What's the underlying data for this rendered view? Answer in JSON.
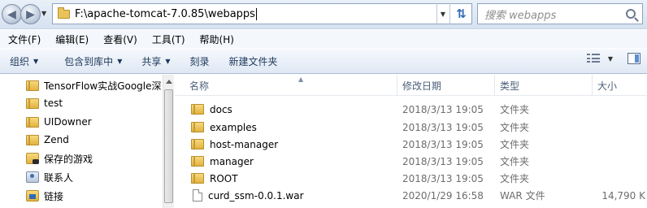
{
  "address_bar": {
    "path": "F:\\apache-tomcat-7.0.85\\webapps",
    "search_placeholder": "搜索 webapps"
  },
  "menu": [
    "文件(F)",
    "编辑(E)",
    "查看(V)",
    "工具(T)",
    "帮助(H)"
  ],
  "toolbar": {
    "organize": "组织",
    "include_in_library": "包含到库中",
    "share": "共享",
    "burn": "刻录",
    "new_folder": "新建文件夹"
  },
  "nav_items": [
    {
      "label": "TensorFlow实战Google深",
      "icon": "folder-icon"
    },
    {
      "label": "test",
      "icon": "folder-icon"
    },
    {
      "label": "UIDowner",
      "icon": "folder-icon"
    },
    {
      "label": "Zend",
      "icon": "folder-icon"
    },
    {
      "label": "保存的游戏",
      "icon": "saved-games-icon"
    },
    {
      "label": "联系人",
      "icon": "contacts-icon"
    },
    {
      "label": "链接",
      "icon": "links-icon"
    }
  ],
  "columns": {
    "name": "名称",
    "date": "修改日期",
    "type": "类型",
    "size": "大小"
  },
  "files": [
    {
      "name": "docs",
      "date": "2018/3/13 19:05",
      "type": "文件夹",
      "size": "",
      "icon": "folder-icon"
    },
    {
      "name": "examples",
      "date": "2018/3/13 19:05",
      "type": "文件夹",
      "size": "",
      "icon": "folder-icon"
    },
    {
      "name": "host-manager",
      "date": "2018/3/13 19:05",
      "type": "文件夹",
      "size": "",
      "icon": "folder-icon"
    },
    {
      "name": "manager",
      "date": "2018/3/13 19:05",
      "type": "文件夹",
      "size": "",
      "icon": "folder-icon"
    },
    {
      "name": "ROOT",
      "date": "2018/3/13 19:05",
      "type": "文件夹",
      "size": "",
      "icon": "folder-icon"
    },
    {
      "name": "curd_ssm-0.0.1.war",
      "date": "2020/1/29 16:58",
      "type": "WAR 文件",
      "size": "14,790 K",
      "icon": "file-icon"
    }
  ]
}
